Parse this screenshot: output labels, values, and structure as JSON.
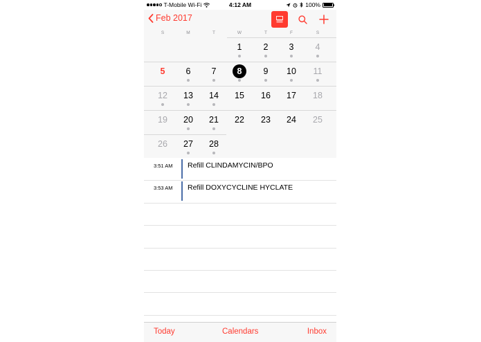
{
  "status_bar": {
    "carrier": "T-Mobile Wi-Fi",
    "time": "4:12 AM",
    "battery": "100%",
    "battery_level": 1.0
  },
  "nav": {
    "back_label": "Feb 2017",
    "icons": [
      "chevron-left-icon",
      "list-view-icon",
      "search-icon",
      "plus-icon"
    ]
  },
  "calendar": {
    "weekdays": [
      "S",
      "M",
      "T",
      "W",
      "T",
      "F",
      "S"
    ],
    "weeks": [
      [
        null,
        null,
        null,
        {
          "n": "1",
          "dot": true
        },
        {
          "n": "2",
          "dot": true
        },
        {
          "n": "3",
          "dot": true
        },
        {
          "n": "4",
          "dot": true
        }
      ],
      [
        {
          "n": "5",
          "dot": false,
          "style": "today"
        },
        {
          "n": "6",
          "dot": true
        },
        {
          "n": "7",
          "dot": true
        },
        {
          "n": "8",
          "dot": true,
          "style": "selected"
        },
        {
          "n": "9",
          "dot": true
        },
        {
          "n": "10",
          "dot": true
        },
        {
          "n": "11",
          "dot": true
        }
      ],
      [
        {
          "n": "12",
          "dot": true
        },
        {
          "n": "13",
          "dot": true
        },
        {
          "n": "14",
          "dot": true
        },
        {
          "n": "15",
          "dot": false
        },
        {
          "n": "16",
          "dot": false
        },
        {
          "n": "17",
          "dot": false
        },
        {
          "n": "18",
          "dot": false
        }
      ],
      [
        {
          "n": "19",
          "dot": false
        },
        {
          "n": "20",
          "dot": true
        },
        {
          "n": "21",
          "dot": true
        },
        {
          "n": "22",
          "dot": false
        },
        {
          "n": "23",
          "dot": false
        },
        {
          "n": "24",
          "dot": false
        },
        {
          "n": "25",
          "dot": false
        }
      ],
      [
        {
          "n": "26",
          "dot": false
        },
        {
          "n": "27",
          "dot": true
        },
        {
          "n": "28",
          "dot": true
        },
        null,
        null,
        null,
        null
      ]
    ]
  },
  "events": [
    {
      "time": "3:51 AM",
      "title": "Refill CLINDAMYCIN/BPO"
    },
    {
      "time": "3:53 AM",
      "title": "Refill DOXYCYCLINE HYCLATE"
    }
  ],
  "tab_bar": {
    "today": "Today",
    "calendars": "Calendars",
    "inbox": "Inbox"
  },
  "colors": {
    "accent": "#ff3b30",
    "event_bar": "#4a6ea8",
    "header_bg": "#f7f7f7"
  }
}
